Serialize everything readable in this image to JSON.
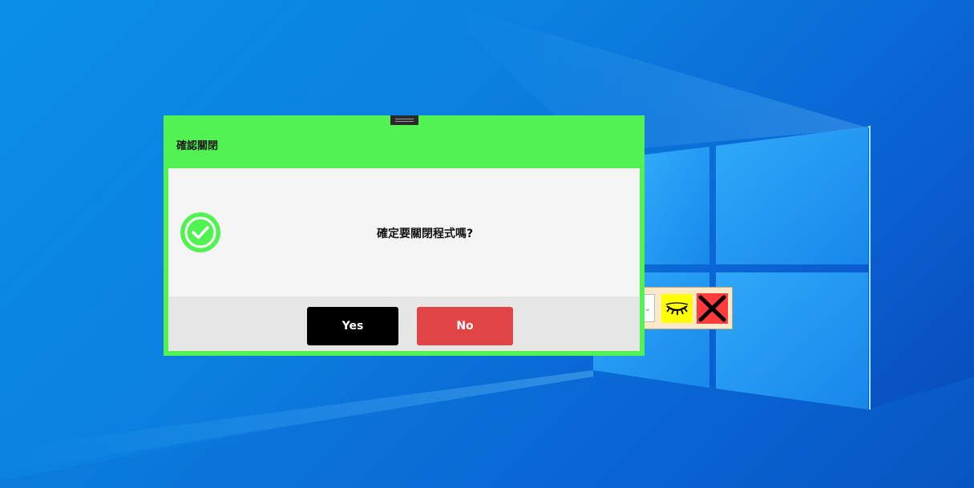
{
  "dialog": {
    "title": "確認關閉",
    "message": "確定要關閉程式嗎?",
    "icon": "check-circle-icon",
    "yes_label": "Yes",
    "no_label": "No"
  },
  "background_toolbar": {
    "eye_icon": "closed-eye-icon",
    "close_icon": "close-x-icon"
  },
  "colors": {
    "dialog_frame": "#52f252",
    "yes_button": "#000000",
    "no_button": "#e04444",
    "eye_button": "#ffff00",
    "close_button": "#ff3b3b"
  }
}
